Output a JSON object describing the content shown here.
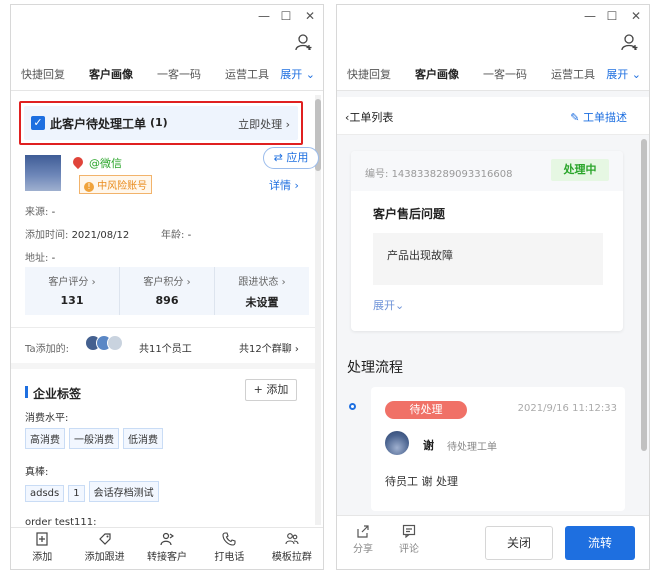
{
  "left": {
    "tabs": [
      "快捷回复",
      "客户画像",
      "一客一码",
      "运营工具"
    ],
    "tabs_more": "展开",
    "workorder_banner": {
      "title": "此客户待处理工单",
      "count": "(1)",
      "action": "立即处理"
    },
    "profile": {
      "wechat": "@微信",
      "risk_badge": "中风险账号",
      "apply_button": "应用",
      "detail_link": "详情"
    },
    "info": {
      "source_label": "来源:",
      "source_value": "-",
      "added_label": "添加时间:",
      "added_value": "2021/08/12",
      "age_label": "年龄:",
      "age_value": "-",
      "address_label": "地址:",
      "address_value": "-"
    },
    "stats": [
      {
        "label": "客户评分",
        "value": "131"
      },
      {
        "label": "客户积分",
        "value": "896"
      },
      {
        "label": "跟进状态",
        "value": "未设置"
      }
    ],
    "added_by": {
      "label": "Ta添加的:",
      "staff": "共11个员工",
      "groups": "共12个群聊"
    },
    "enterprise_tags": {
      "title": "企业标签",
      "add_button": "添加",
      "groups": [
        {
          "name": "消费水平:",
          "tags": [
            "高消费",
            "一般消费",
            "低消费"
          ]
        },
        {
          "name": "真棒:",
          "tags": [
            "adsds",
            "1",
            "会话存档测试"
          ]
        }
      ],
      "cut_text": "order test111:"
    },
    "bottom_nav": [
      "添加",
      "添加跟进",
      "转接客户",
      "打电话",
      "模板拉群"
    ]
  },
  "right": {
    "tabs": [
      "快捷回复",
      "客户画像",
      "一客一码",
      "运营工具"
    ],
    "tabs_more": "展开",
    "back_label": "工单列表",
    "describe_label": "工单描述",
    "ticket": {
      "number_label": "编号:",
      "number": "1438338289093316608",
      "status": "处理中",
      "title": "客户售后问题",
      "description": "产品出现故障",
      "expand": "展开"
    },
    "flow_title": "处理流程",
    "flow": {
      "status": "待处理",
      "time": "2021/9/16 11:12:33",
      "user": "谢",
      "action": "待处理工单",
      "note": "待员工 谢 处理"
    },
    "bottom": {
      "share": "分享",
      "comment": "评论",
      "close": "关闭",
      "transfer": "流转"
    }
  },
  "colors": {
    "accent": "#1e6fe0",
    "highlight_border": "#e02020",
    "status_green": "#2aa52a",
    "status_red_bg": "#f07167"
  }
}
